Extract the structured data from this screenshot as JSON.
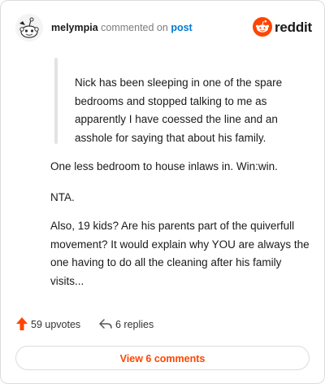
{
  "header": {
    "username": "melympia",
    "verb": "commented on",
    "post_link": "post",
    "brand": "reddit"
  },
  "comment": {
    "quote": "Nick has been sleeping in one of the spare bedrooms and stopped talking to me as apparently I have coessed the line and an asshole for saying that about his family.",
    "paragraphs": [
      "One less bedroom to house inlaws in. Win:win.",
      "NTA.",
      "Also, 19 kids? Are his parents part of the quiverfull movement? It would explain why YOU are always the one having to do all the cleaning after his family visits..."
    ]
  },
  "stats": {
    "upvotes": "59 upvotes",
    "replies": "6 replies"
  },
  "footer": {
    "view_label": "View 6 comments"
  },
  "colors": {
    "accent": "#ff4500",
    "link": "#0079d3"
  }
}
